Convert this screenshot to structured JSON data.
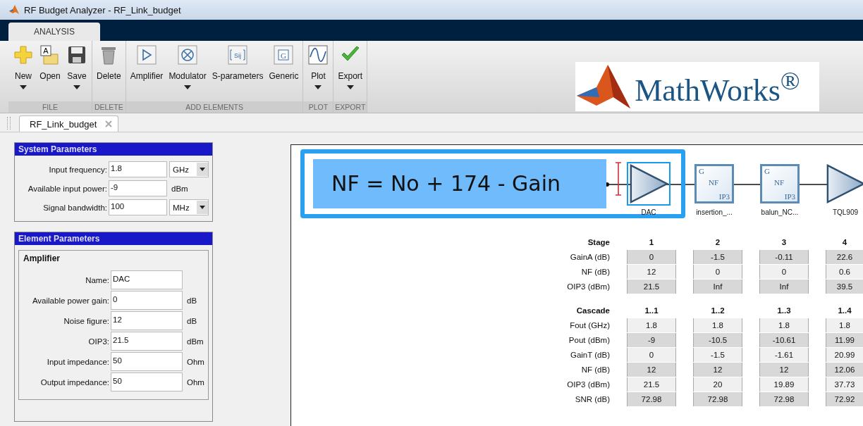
{
  "window": {
    "title": "RF Budget Analyzer - RF_Link_budget"
  },
  "ribbon_tabs": [
    {
      "label": "ANALYSIS",
      "selected": true
    }
  ],
  "ribbon_groups": [
    {
      "label": "FILE",
      "buttons": [
        {
          "kind": "new",
          "label": "New",
          "menu": true
        },
        {
          "kind": "open",
          "label": "Open",
          "menu": false,
          "icon_text": "A"
        },
        {
          "kind": "save",
          "label": "Save",
          "menu": true
        }
      ]
    },
    {
      "label": "DELETE",
      "buttons": [
        {
          "kind": "delete",
          "label": "Delete",
          "menu": false
        }
      ]
    },
    {
      "label": "ADD ELEMENTS",
      "buttons": [
        {
          "kind": "amplifier",
          "label": "Amplifier",
          "menu": false
        },
        {
          "kind": "modulator",
          "label": "Modulator",
          "menu": true
        },
        {
          "kind": "sparams",
          "label": "S-parameters",
          "menu": false,
          "icon_text": "Sij"
        },
        {
          "kind": "generic",
          "label": "Generic",
          "menu": false,
          "icon_text": "G"
        }
      ]
    },
    {
      "label": "PLOT",
      "buttons": [
        {
          "kind": "plot",
          "label": "Plot",
          "menu": true
        }
      ]
    },
    {
      "label": "EXPORT",
      "buttons": [
        {
          "kind": "export",
          "label": "Export",
          "menu": true
        }
      ]
    }
  ],
  "logo": {
    "text": "MathWorks$^{®}$"
  },
  "document_tabs": [
    {
      "label": "RF_Link_budget",
      "selected": true
    }
  ],
  "system_parameters": {
    "title": "System Parameters",
    "fields": [
      {
        "label": "Input frequency:",
        "value": "1.8",
        "unit": "GHz",
        "kind": "dropdown"
      },
      {
        "label": "Available input power:",
        "value": "-9",
        "unit": "dBm",
        "kind": "text"
      },
      {
        "label": "Signal bandwidth:",
        "value": "100",
        "unit": "MHz",
        "kind": "dropdown"
      }
    ]
  },
  "element_parameters": {
    "title": "Element Parameters",
    "group": "Amplifier",
    "fields": [
      {
        "label": "Name:",
        "value": "DAC"
      },
      {
        "label": "Available power gain:",
        "value": "0",
        "unit": "dB"
      },
      {
        "label": "Noise figure:",
        "value": "12",
        "unit": "dB"
      },
      {
        "label": "OIP3:",
        "value": "21.5",
        "unit": "dBm"
      },
      {
        "label": "Input impedance:",
        "value": "50",
        "unit": "Ohm"
      },
      {
        "label": "Output impedance:",
        "value": "50",
        "unit": "Ohm"
      }
    ]
  },
  "formula": {
    "text": "NF = No + 174 - Gain"
  },
  "elements": [
    {
      "kind": "amplifier",
      "label": "DAC",
      "selected": true
    },
    {
      "kind": "generic",
      "label": "insertion_...",
      "selected": false,
      "lines": [
        "G",
        "NF",
        "IP3"
      ]
    },
    {
      "kind": "generic",
      "label": "balun_NC...",
      "selected": false,
      "lines": [
        "G",
        "NF",
        "IP3"
      ]
    },
    {
      "kind": "amplifier",
      "label": "TQL909",
      "selected": false
    }
  ],
  "stage_table": {
    "header": "Stage",
    "columns": [
      "1",
      "2",
      "3",
      "4"
    ],
    "rows": [
      {
        "label": "GainA (dB)",
        "values": [
          "0",
          "-1.5",
          "-0.11",
          "22.6"
        ]
      },
      {
        "label": "NF (dB)",
        "values": [
          "12",
          "0",
          "0",
          "0.6"
        ]
      },
      {
        "label": "OIP3 (dBm)",
        "values": [
          "21.5",
          "Inf",
          "Inf",
          "39.5"
        ]
      }
    ]
  },
  "cascade_table": {
    "header": "Cascade",
    "columns": [
      "1..1",
      "1..2",
      "1..3",
      "1..4"
    ],
    "rows": [
      {
        "label": "Fout (GHz)",
        "values": [
          "1.8",
          "1.8",
          "1.8",
          "1.8"
        ]
      },
      {
        "label": "Pout (dBm)",
        "values": [
          "-9",
          "-10.5",
          "-10.61",
          "11.99"
        ]
      },
      {
        "label": "GainT (dB)",
        "values": [
          "0",
          "-1.5",
          "-1.61",
          "20.99"
        ]
      },
      {
        "label": "NF (dB)",
        "values": [
          "12",
          "12",
          "12",
          "12.06"
        ]
      },
      {
        "label": "OIP3 (dBm)",
        "values": [
          "21.5",
          "20",
          "19.89",
          "37.73"
        ]
      },
      {
        "label": "SNR (dB)",
        "values": [
          "72.98",
          "72.98",
          "72.98",
          "72.92"
        ]
      }
    ]
  }
}
